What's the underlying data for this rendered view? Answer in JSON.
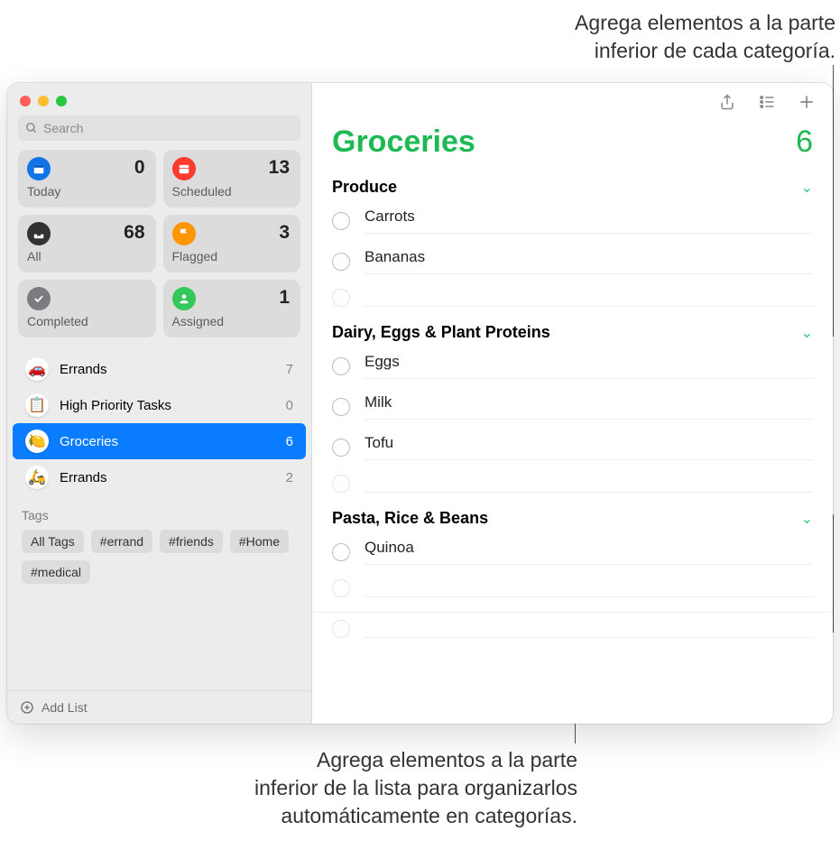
{
  "annotations": {
    "top": "Agrega elementos a la parte\ninferior de cada categoría.",
    "bottom": "Agrega elementos a la parte\ninferior de la lista para organizarlos\nautomáticamente en categorías."
  },
  "search": {
    "placeholder": "Search"
  },
  "smart": {
    "today": {
      "label": "Today",
      "count": "0",
      "color": "#1173e6"
    },
    "scheduled": {
      "label": "Scheduled",
      "count": "13",
      "color": "#ff3b30"
    },
    "all": {
      "label": "All",
      "count": "68",
      "color": "#323232"
    },
    "flagged": {
      "label": "Flagged",
      "count": "3",
      "color": "#ff9500"
    },
    "completed": {
      "label": "Completed",
      "count": "",
      "color": "#7b7b80"
    },
    "assigned": {
      "label": "Assigned",
      "count": "1",
      "color": "#34c759"
    }
  },
  "lists": [
    {
      "name": "Errands",
      "count": "7",
      "emoji": "🚗"
    },
    {
      "name": "High Priority Tasks",
      "count": "0",
      "emoji": "📋"
    },
    {
      "name": "Groceries",
      "count": "6",
      "emoji": "🍋"
    },
    {
      "name": "Errands",
      "count": "2",
      "emoji": "🛵"
    }
  ],
  "tags": {
    "label": "Tags",
    "items": [
      "All Tags",
      "#errand",
      "#friends",
      "#Home",
      "#medical"
    ]
  },
  "addList": "Add List",
  "main": {
    "title": "Groceries",
    "titleColor": "#1db954",
    "count": "6",
    "sections": [
      {
        "name": "Produce",
        "items": [
          "Carrots",
          "Bananas"
        ]
      },
      {
        "name": "Dairy, Eggs & Plant Proteins",
        "items": [
          "Eggs",
          "Milk",
          "Tofu"
        ]
      },
      {
        "name": "Pasta, Rice & Beans",
        "items": [
          "Quinoa"
        ]
      }
    ]
  }
}
